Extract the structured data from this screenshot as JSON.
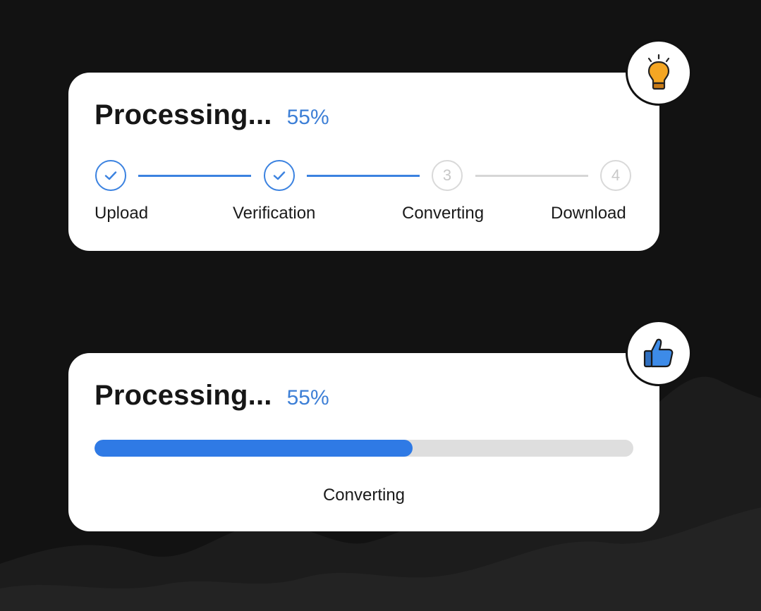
{
  "colors": {
    "background": "#121212",
    "accent": "#3b82e0",
    "inactive": "#d6d6d6",
    "card": "#ffffff"
  },
  "stepper_card": {
    "title": "Processing...",
    "percent": "55%",
    "progress": 0.55,
    "steps": [
      {
        "label": "Upload",
        "number": "1",
        "state": "done"
      },
      {
        "label": "Verification",
        "number": "2",
        "state": "done"
      },
      {
        "label": "Converting",
        "number": "3",
        "state": "pending"
      },
      {
        "label": "Download",
        "number": "4",
        "state": "pending"
      }
    ],
    "badge_icon": "lightbulb-icon"
  },
  "bar_card": {
    "title": "Processing...",
    "percent": "55%",
    "progress": 0.59,
    "status": "Converting",
    "badge_icon": "thumbs-up-icon"
  }
}
